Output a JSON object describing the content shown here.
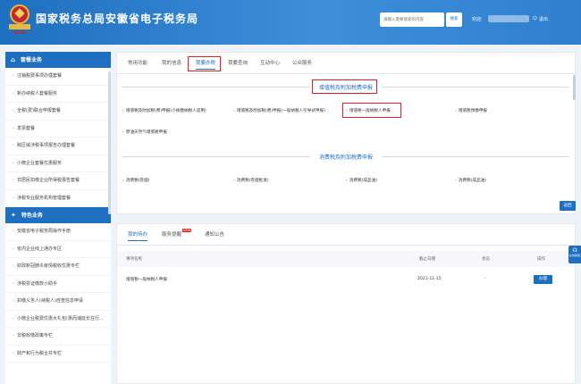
{
  "header": {
    "title": "国家税务总局安徽省电子税务局",
    "emblem_text": "TAXES",
    "search_placeholder": "请输入需要搜索的内容",
    "search_button": "搜索",
    "welcome": "欢迎:",
    "exit": "退出",
    "brand_color": "#1e6fc0"
  },
  "sidebar": {
    "section1": {
      "icon": "home-icon",
      "title": "套餐业务"
    },
    "section1_items": [
      "注销税费事项办理套餐",
      "新办纳税人套餐服务",
      "全税(费)联合申报套餐",
      "发票套餐",
      "跨区域涉税事项报告办理套餐",
      "小微企业套餐优惠服务",
      "非居民扣缴企业所得税报告套餐",
      "涉税专业服务机构管理套餐"
    ],
    "section2": {
      "icon": "star-icon",
      "title": "特色业务"
    },
    "section2_items": [
      "安徽省电子税务局操作手册",
      "省内企业线上通办专区",
      "财政新冠肺炎疫情税收优惠专栏",
      "涉税票证缴款小助手",
      "扣缴义务人(纳税人)自查信息申请",
      "小微企业税费优惠大礼包(惠而浦延长在行...",
      "非税收缴政策专栏",
      "财产和行为税合并专栏"
    ]
  },
  "main_tabs": [
    "常用功能",
    "我的信息",
    "我要办税",
    "我要查询",
    "互动中心",
    "公众服务"
  ],
  "active_tab": "我要办税",
  "section_a": {
    "title": "增值税及附加税费申报",
    "items": [
      "增值税及附加税(费)申报(小规模纳税人适用)",
      "增值税及附加税(费)申报(一般纳税人引导式申报)",
      "增值税一般纳税人申报",
      "增值税预缴申报",
      "原油天然气增值税申报"
    ],
    "highlighted_item": "增值税一般纳税人申报"
  },
  "section_b": {
    "title": "消费税及附加税费申报",
    "items": [
      "消费税(卷烟)",
      "消费税(卷烟批发)",
      "消费税(成品油)",
      "消费税(成品油)"
    ]
  },
  "back_button": "返回",
  "lower_tabs": [
    "我的待办",
    "服务提醒",
    "通知公告"
  ],
  "new_badge": "NEW",
  "table": {
    "columns": [
      "事项名称",
      "截止日期",
      "状态",
      "操作"
    ],
    "rows": [
      {
        "name": "增值税一般纳税人申报",
        "deadline": "2021-11-15",
        "status": "-",
        "action": "办理"
      }
    ]
  },
  "float_service": {
    "icon": "headset-icon",
    "label": "在线客服"
  }
}
